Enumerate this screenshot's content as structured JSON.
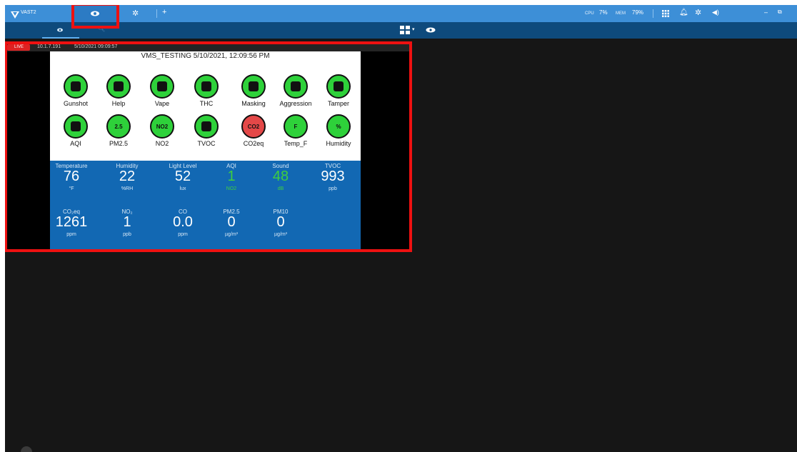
{
  "app": {
    "title": "VAST2"
  },
  "topbar": {
    "tabs": [
      "view-tab",
      "settings-tab"
    ],
    "add_label": "+",
    "cpu_label": "CPU",
    "cpu_value": "7%",
    "mem_label": "MEM",
    "mem_value": "79%",
    "window_minimize": "–"
  },
  "subbar": {
    "icons": [
      "eye-icon",
      "search-icon",
      "layout-icon",
      "chevron-down-icon",
      "hub-icon"
    ]
  },
  "video": {
    "live_label": "LIVE",
    "ip": "10.1.7.191",
    "timestamp": "5/10/2021 09:09:57",
    "screen_title": "VMS_TESTING 5/10/2021, 12:09:56 PM"
  },
  "sensors_row1": [
    {
      "label": "Gunshot",
      "icon": "gun-icon"
    },
    {
      "label": "Help",
      "icon": "person-icon"
    },
    {
      "label": "Vape",
      "icon": "vape-icon"
    },
    {
      "label": "THC",
      "icon": "leaf-icon"
    },
    {
      "label": "Masking",
      "icon": "masked-person-icon"
    },
    {
      "label": "Aggression",
      "icon": "aggression-icon"
    },
    {
      "label": "Tamper",
      "icon": "hammer-icon"
    }
  ],
  "sensors_row2": [
    {
      "label": "AQI",
      "icon": "wind-icon",
      "badge": ""
    },
    {
      "label": "PM2.5",
      "icon": "particles-icon",
      "badge": "2.5"
    },
    {
      "label": "NO2",
      "icon": "cloud-icon",
      "badge": "NO2"
    },
    {
      "label": "TVOC",
      "icon": "biohazard-icon",
      "badge": ""
    },
    {
      "label": "CO2eq",
      "icon": "co2-cloud-icon",
      "badge": "CO2",
      "status": "alert"
    },
    {
      "label": "Temp_F",
      "icon": "thermometer-icon",
      "badge": "F"
    },
    {
      "label": "Humidity",
      "icon": "humidity-icon",
      "badge": "%"
    }
  ],
  "metrics_row1": [
    {
      "label": "Temperature",
      "value": "76",
      "unit": "°F"
    },
    {
      "label": "Humidity",
      "value": "22",
      "unit": "%RH"
    },
    {
      "label": "Light Level",
      "value": "52",
      "unit": "lux"
    },
    {
      "label": "AQI",
      "value": "1",
      "unit": "NO2",
      "highlight": true
    },
    {
      "label": "Sound",
      "value": "48",
      "unit": "dB",
      "highlight": true
    },
    {
      "label": "TVOC",
      "value": "993",
      "unit": "ppb"
    }
  ],
  "metrics_row2": [
    {
      "label": "CO₂eq",
      "value": "1261",
      "unit": "ppm"
    },
    {
      "label": "NO₂",
      "value": "1",
      "unit": "ppb"
    },
    {
      "label": "CO",
      "value": "0.0",
      "unit": "ppm"
    },
    {
      "label": "PM2.5",
      "value": "0",
      "unit": "µg/m³"
    },
    {
      "label": "PM10",
      "value": "0",
      "unit": "µg/m³"
    }
  ],
  "colors": {
    "topbar": "#3d8fd7",
    "subbar": "#0e4a7c",
    "background": "#161616",
    "sensor_ok": "#2ed13a",
    "sensor_alert": "#e44848",
    "metrics_panel": "#1268b3",
    "highlight": "#ee1111"
  }
}
